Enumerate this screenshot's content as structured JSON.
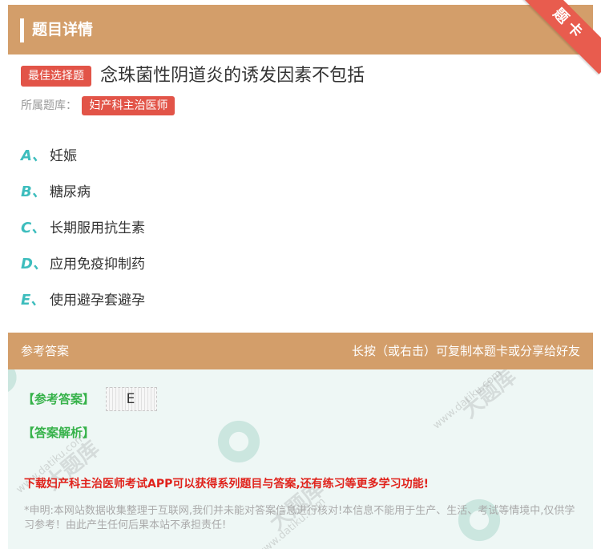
{
  "header": {
    "title": "题目详情",
    "ribbon": "题卡"
  },
  "question": {
    "type_badge": "最佳选择题",
    "text": "念珠菌性阴道炎的诱发因素不包括",
    "bank_label": "所属题库：",
    "bank_name": "妇产科主治医师"
  },
  "options": [
    {
      "letter": "A、",
      "text": "妊娠"
    },
    {
      "letter": "B、",
      "text": "糖尿病"
    },
    {
      "letter": "C、",
      "text": "长期服用抗生素"
    },
    {
      "letter": "D、",
      "text": "应用免疫抑制药"
    },
    {
      "letter": "E、",
      "text": "使用避孕套避孕"
    }
  ],
  "answer_section": {
    "title": "参考答案",
    "hint": "长按（或右击）可复制本题卡或分享给好友",
    "answer_label": "【参考答案】",
    "answer_value": "E",
    "analysis_label": "【答案解析】",
    "promo": "下载妇产科主治医师考试APP可以获得系列题目与答案,还有练习等更多学习功能!",
    "disclaimer": "*申明:本网站数据收集整理于互联网,我们并未能对答案信息进行核对!本信息不能用于生产、生活、考试等情境中,仅供学习参考！由此产生任何后果本站不承担责任!"
  },
  "watermark": {
    "brand": "大题库",
    "url": "www.datiku.com"
  },
  "colors": {
    "header": "#d39e6a",
    "badge": "#e25448",
    "option_letter": "#3dbdbd",
    "answer_green": "#36b24a",
    "promo_red": "#e0231c"
  }
}
